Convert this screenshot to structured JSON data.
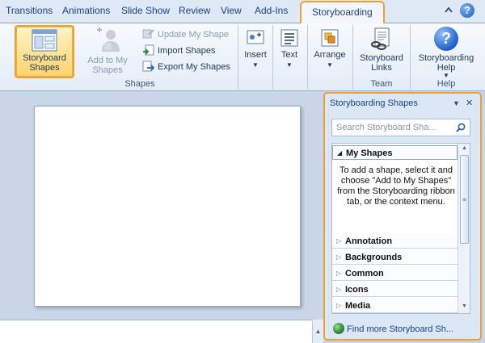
{
  "tabs": [
    {
      "label": "Transitions"
    },
    {
      "label": "Animations"
    },
    {
      "label": "Slide Show"
    },
    {
      "label": "Review"
    },
    {
      "label": "View"
    },
    {
      "label": "Add-Ins"
    },
    {
      "label": "Storyboarding",
      "active": true
    }
  ],
  "window_controls": {
    "minimize_ribbon_icon": "chevron-up-icon",
    "help_icon": "help-icon",
    "help_glyph": "?"
  },
  "ribbon": {
    "storyboard_shapes": {
      "line1": "Storyboard",
      "line2": "Shapes",
      "selected": true
    },
    "add_to_my_shapes": {
      "line1": "Add to My",
      "line2": "Shapes",
      "disabled": true
    },
    "update_my_shape": {
      "label": "Update My Shape",
      "disabled": true
    },
    "import_shapes": {
      "label": "Import Shapes"
    },
    "export_my_shapes": {
      "label": "Export My Shapes"
    },
    "shapes_group_label": "Shapes",
    "insert": {
      "label": "Insert"
    },
    "text": {
      "label": "Text"
    },
    "arrange": {
      "label": "Arrange"
    },
    "storyboard_links": {
      "line1": "Storyboard",
      "line2": "Links"
    },
    "team_group_label": "Team",
    "storyboarding_help": {
      "line1": "Storyboarding",
      "line2": "Help"
    },
    "help_group_label": "Help",
    "help_glyph": "?",
    "dropdown_glyph": "▼"
  },
  "pane": {
    "title": "Storyboarding Shapes",
    "menu_glyph": "▼",
    "close_glyph": "✕",
    "search_placeholder": "Search Storyboard Sha...",
    "categories": [
      {
        "label": "My Shapes",
        "expanded": true
      },
      {
        "label": "Annotation"
      },
      {
        "label": "Backgrounds"
      },
      {
        "label": "Common"
      },
      {
        "label": "Icons"
      },
      {
        "label": "Media"
      }
    ],
    "my_shapes_description": "To add a shape, select it and choose \"Add to My Shapes\" from the Storyboarding ribbon tab, or the context menu.",
    "expanded_glyph": "◢",
    "collapsed_glyph": "▷",
    "scroll_up_glyph": "▲",
    "scroll_down_glyph": "▼",
    "thumb_grip_glyph": "≡",
    "find_more_label": "Find more Storyboard Sh..."
  },
  "notes_scroll_glyph": "▲",
  "colors": {
    "accent_highlight": "#f0a030",
    "ribbon_text": "#15428b",
    "workspace": "#c8d6e8"
  }
}
